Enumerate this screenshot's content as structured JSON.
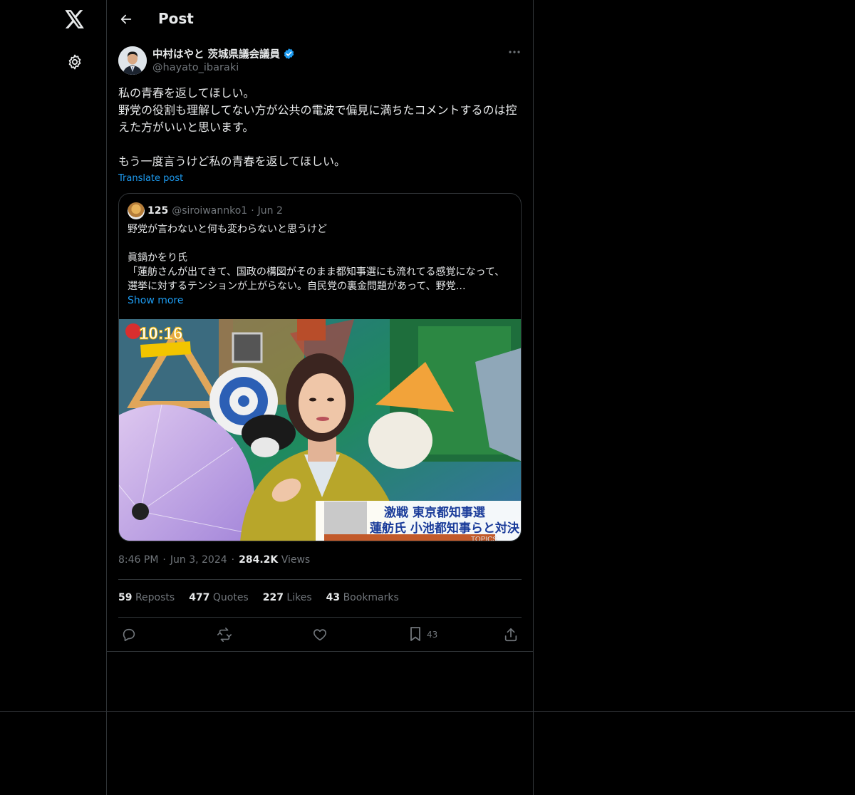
{
  "header": {
    "title": "Post"
  },
  "author": {
    "name": "中村はやと 茨城県議会議員",
    "handle": "@hayato_ibaraki",
    "verified_color": "#1d9bf0"
  },
  "post": {
    "text": "私の青春を返してほしい。\n野党の役割も理解してない方が公共の電波で偏見に満ちたコメントするのは控えた方がいいと思います。\n\nもう一度言うけど私の青春を返してほしい。",
    "translate_label": "Translate post",
    "time": "8:46 PM",
    "date": "Jun 3, 2024",
    "views_count": "284.2K",
    "views_label": "Views"
  },
  "quote": {
    "name": "125",
    "handle": "@siroiwannko1",
    "date": "Jun 2",
    "text": "野党が言わないと何も変わらないと思うけど\n\n眞鍋かをり氏\n「蓮舫さんが出てきて、国政の構図がそのまま都知事選にも流れてる感覚になって、選挙に対するテンションが上がらない。自民党の裏金問題があって、野党…",
    "show_more": "Show more",
    "media": {
      "clock": "10:16",
      "caption_line1": "激戦 東京都知事選",
      "caption_line2": "蓮舫氏 小池都知事らと対決",
      "corner": "TOPICS"
    }
  },
  "stats": {
    "reposts_count": "59",
    "reposts_label": "Reposts",
    "quotes_count": "477",
    "quotes_label": "Quotes",
    "likes_count": "227",
    "likes_label": "Likes",
    "bookmarks_count": "43",
    "bookmarks_label": "Bookmarks"
  },
  "actions": {
    "bookmark_count": "43"
  },
  "icons": [
    "x-logo-icon",
    "settings-icon",
    "back-arrow-icon",
    "more-icon",
    "verified-badge-icon",
    "reply-icon",
    "repost-icon",
    "like-icon",
    "bookmark-icon",
    "share-icon"
  ],
  "colors": {
    "background": "#000000",
    "text": "#e7e9ea",
    "secondary": "#71767b",
    "accent": "#1d9bf0",
    "border": "#2f3336"
  }
}
